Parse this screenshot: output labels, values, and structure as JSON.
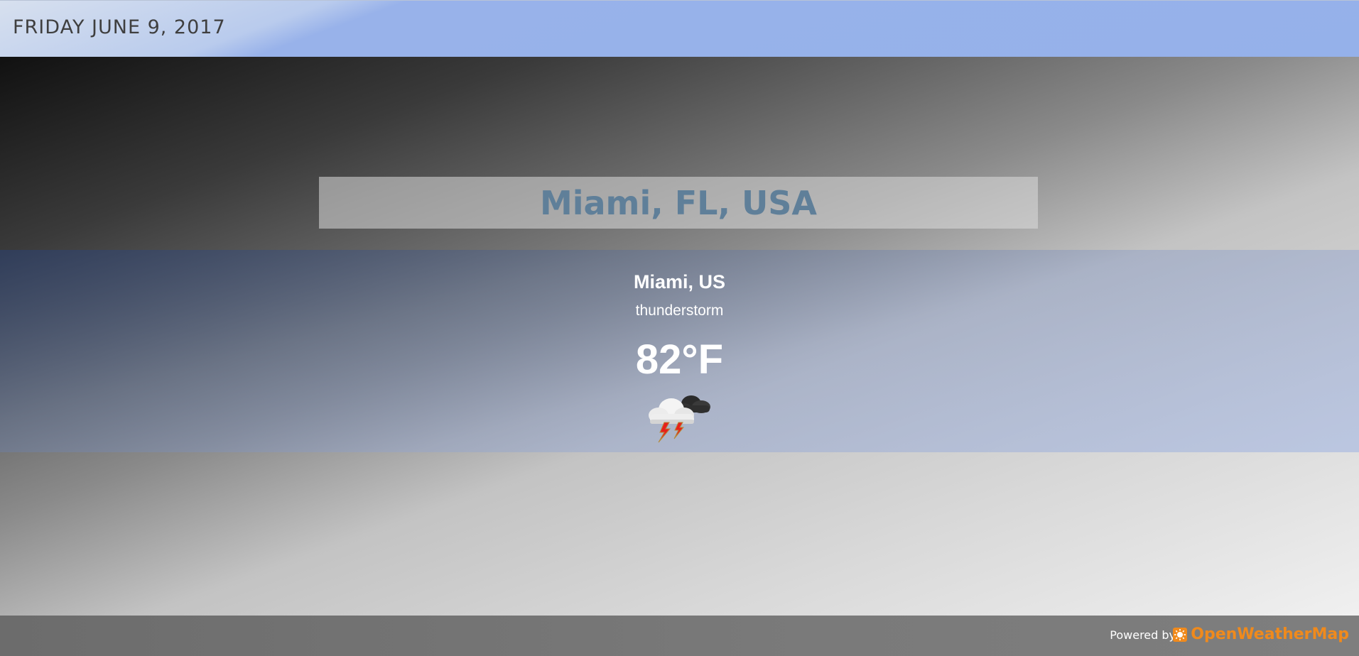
{
  "header": {
    "date": "FRIDAY JUNE 9, 2017"
  },
  "location": {
    "title": "Miami, FL, USA"
  },
  "weather": {
    "city": "Miami, US",
    "condition": "thunderstorm",
    "temperature": "82°F",
    "icon": "thunderstorm-icon"
  },
  "footer": {
    "powered_by": "Powered by",
    "provider": "OpenWeatherMap"
  },
  "colors": {
    "header_bg": "#95b1ea",
    "location_title": "#5f7f99",
    "provider_brand": "#f08a1c",
    "footer_bg": "#7a7a7a"
  }
}
